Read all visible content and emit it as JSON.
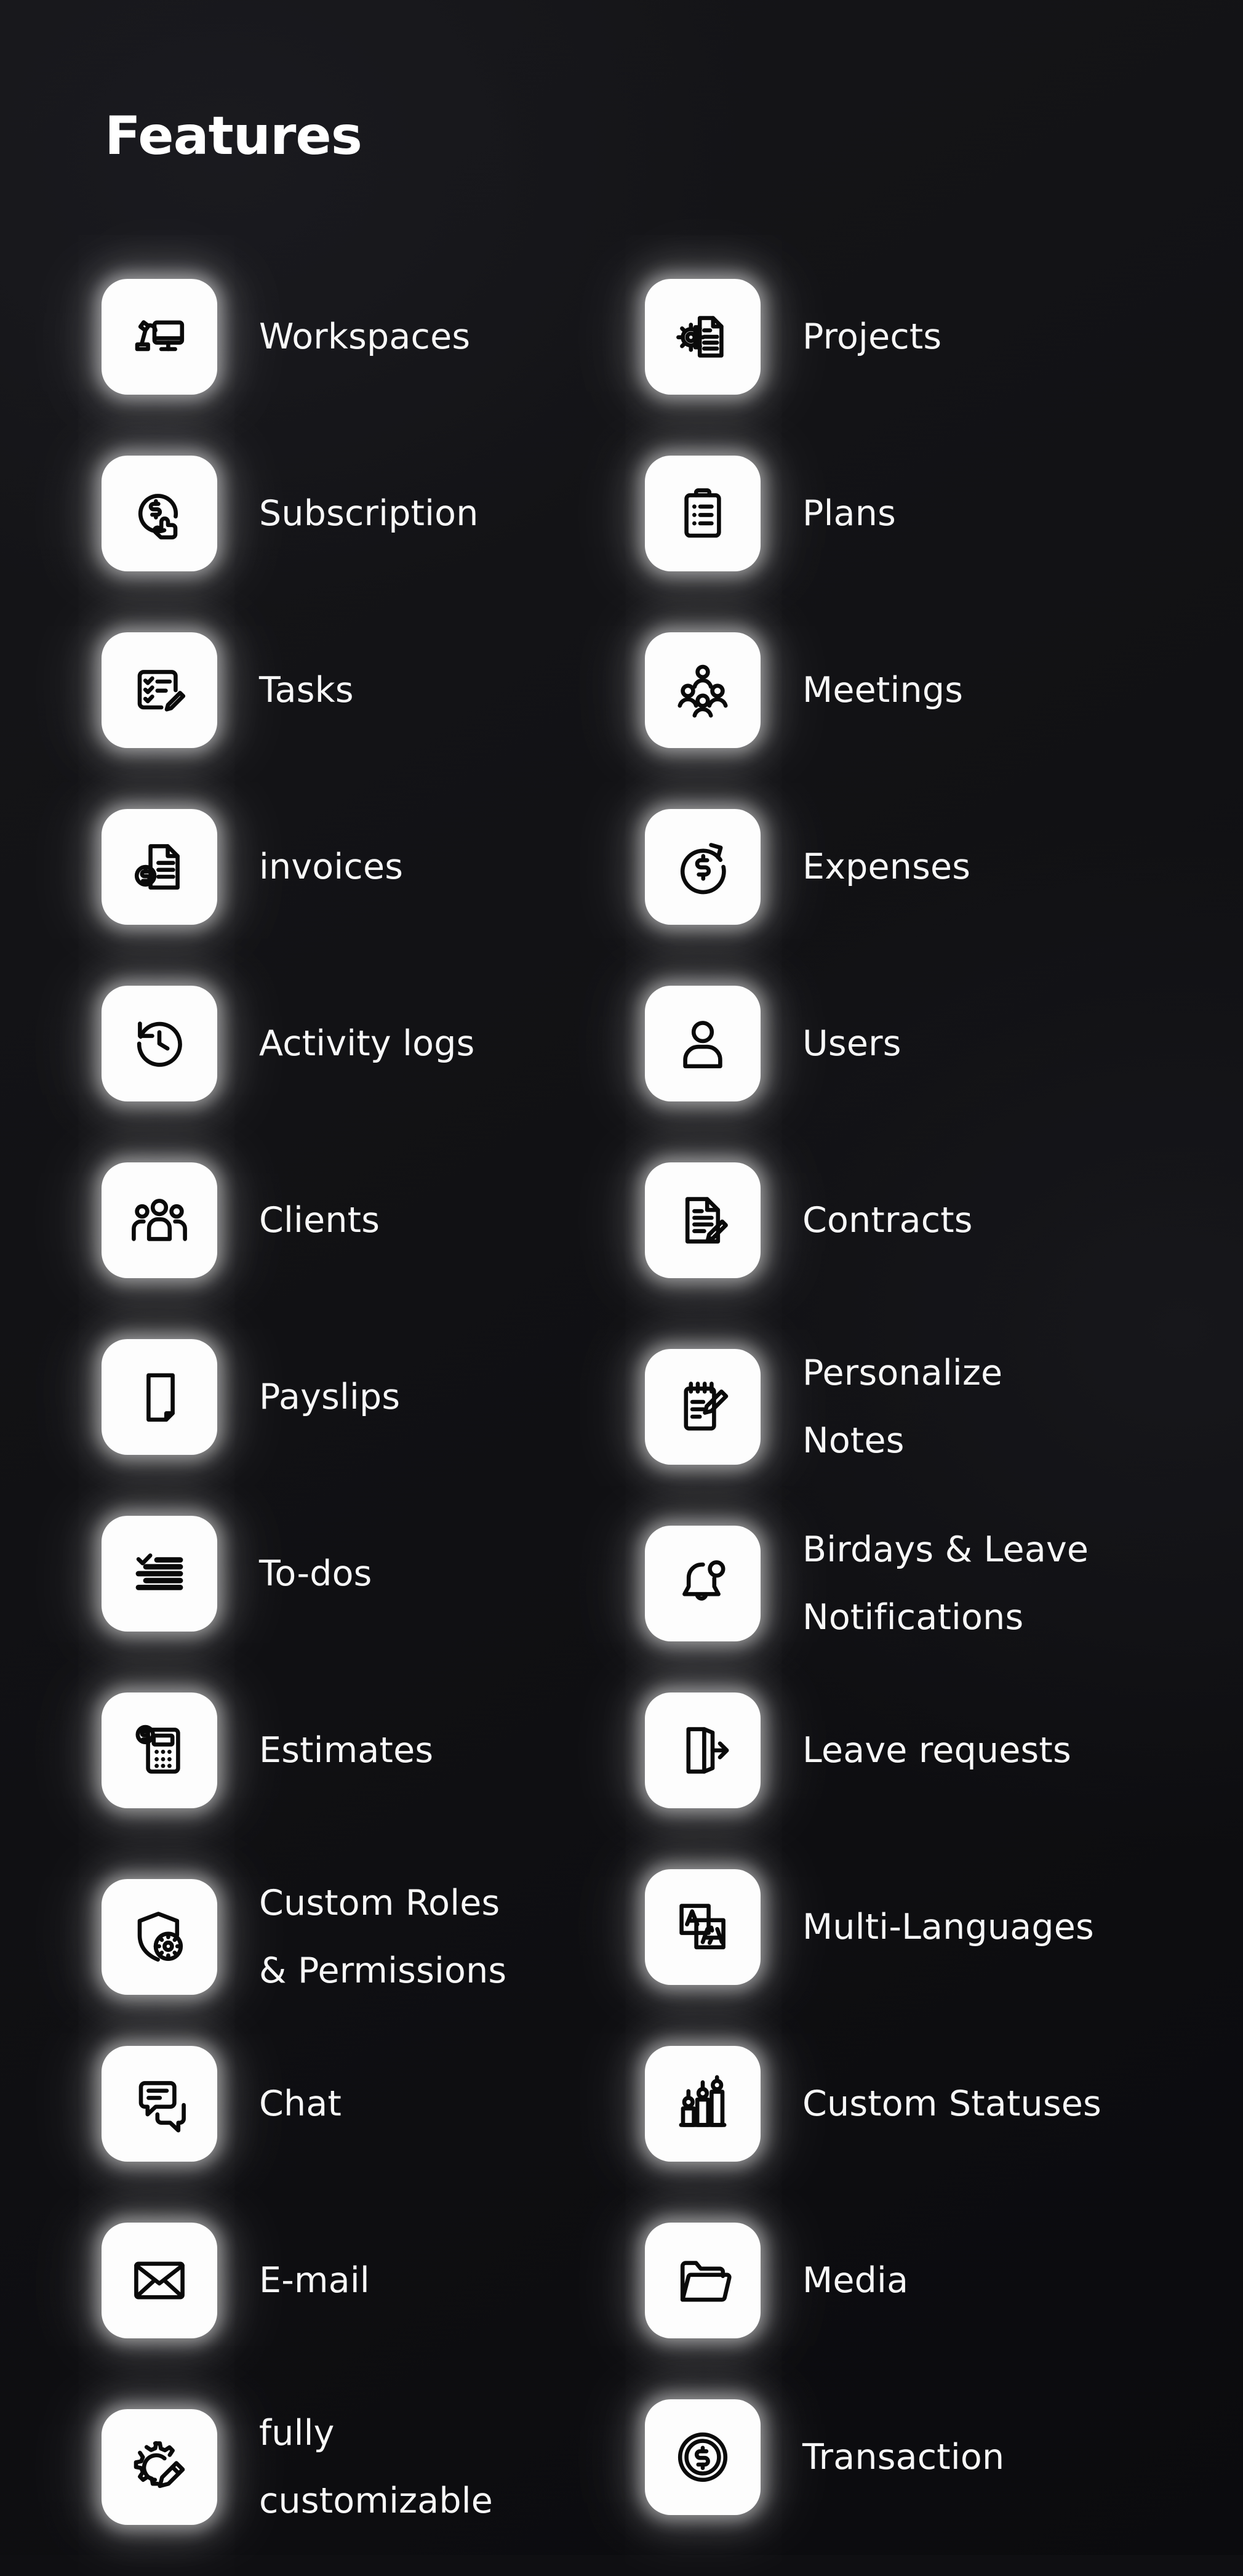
{
  "page": {
    "title": "Features",
    "background_color": "#0f0f12",
    "tile_color": "#fdfdfd",
    "text_color": "#f7f7f7",
    "glow_color": "#ffffff"
  },
  "features": [
    {
      "row": 1,
      "left": {
        "label": "Workspaces",
        "icon": "desk-monitor-lamp-icon"
      },
      "right": {
        "label": "Projects",
        "icon": "document-gear-icon"
      }
    },
    {
      "row": 2,
      "left": {
        "label": "Subscription",
        "icon": "dollar-click-hand-icon"
      },
      "right": {
        "label": "Plans",
        "icon": "clipboard-list-icon"
      }
    },
    {
      "row": 3,
      "left": {
        "label": "Tasks",
        "icon": "checklist-pencil-icon"
      },
      "right": {
        "label": "Meetings",
        "icon": "people-group-icon"
      }
    },
    {
      "row": 4,
      "left": {
        "label": "invoices",
        "icon": "invoice-dollar-icon"
      },
      "right": {
        "label": "Expenses",
        "icon": "dollar-circle-arrow-icon"
      }
    },
    {
      "row": 5,
      "left": {
        "label": "Activity logs",
        "icon": "clock-history-icon"
      },
      "right": {
        "label": "Users",
        "icon": "user-person-icon"
      }
    },
    {
      "row": 6,
      "left": {
        "label": "Clients",
        "icon": "users-multiple-icon"
      },
      "right": {
        "label": "Contracts",
        "icon": "document-signature-icon"
      }
    },
    {
      "row": 7,
      "left": {
        "label": "Payslips",
        "icon": "payslip-receipt-icon"
      },
      "right": {
        "label": "Personalize\nNotes",
        "icon": "notepad-pencil-icon"
      }
    },
    {
      "row": 8,
      "left": {
        "label": "To-dos",
        "icon": "todo-lines-check-icon"
      },
      "right": {
        "label": "Birdays & Leave\nNotifications",
        "icon": "bell-notification-icon"
      }
    },
    {
      "row": 9,
      "left": {
        "label": "Estimates",
        "icon": "calculator-dollar-icon"
      },
      "right": {
        "label": "Leave requests",
        "icon": "door-exit-arrow-icon"
      }
    },
    {
      "row": 10,
      "left": {
        "label": "Custom Roles\n& Permissions",
        "icon": "shield-settings-icon"
      },
      "right": {
        "label": "Multi-Languages",
        "icon": "translate-language-icon"
      }
    },
    {
      "row": 11,
      "left": {
        "label": "Chat",
        "icon": "chat-bubbles-icon"
      },
      "right": {
        "label": "Custom Statuses",
        "icon": "bar-chart-pins-icon"
      }
    },
    {
      "row": 12,
      "left": {
        "label": "E-mail",
        "icon": "envelope-mail-icon"
      },
      "right": {
        "label": "Media",
        "icon": "folder-open-icon"
      }
    },
    {
      "row": 13,
      "left": {
        "label": "fully\ncustomizable",
        "icon": "gear-pencil-icon"
      },
      "right": {
        "label": "Transaction",
        "icon": "coin-dollar-circle-icon"
      }
    }
  ]
}
